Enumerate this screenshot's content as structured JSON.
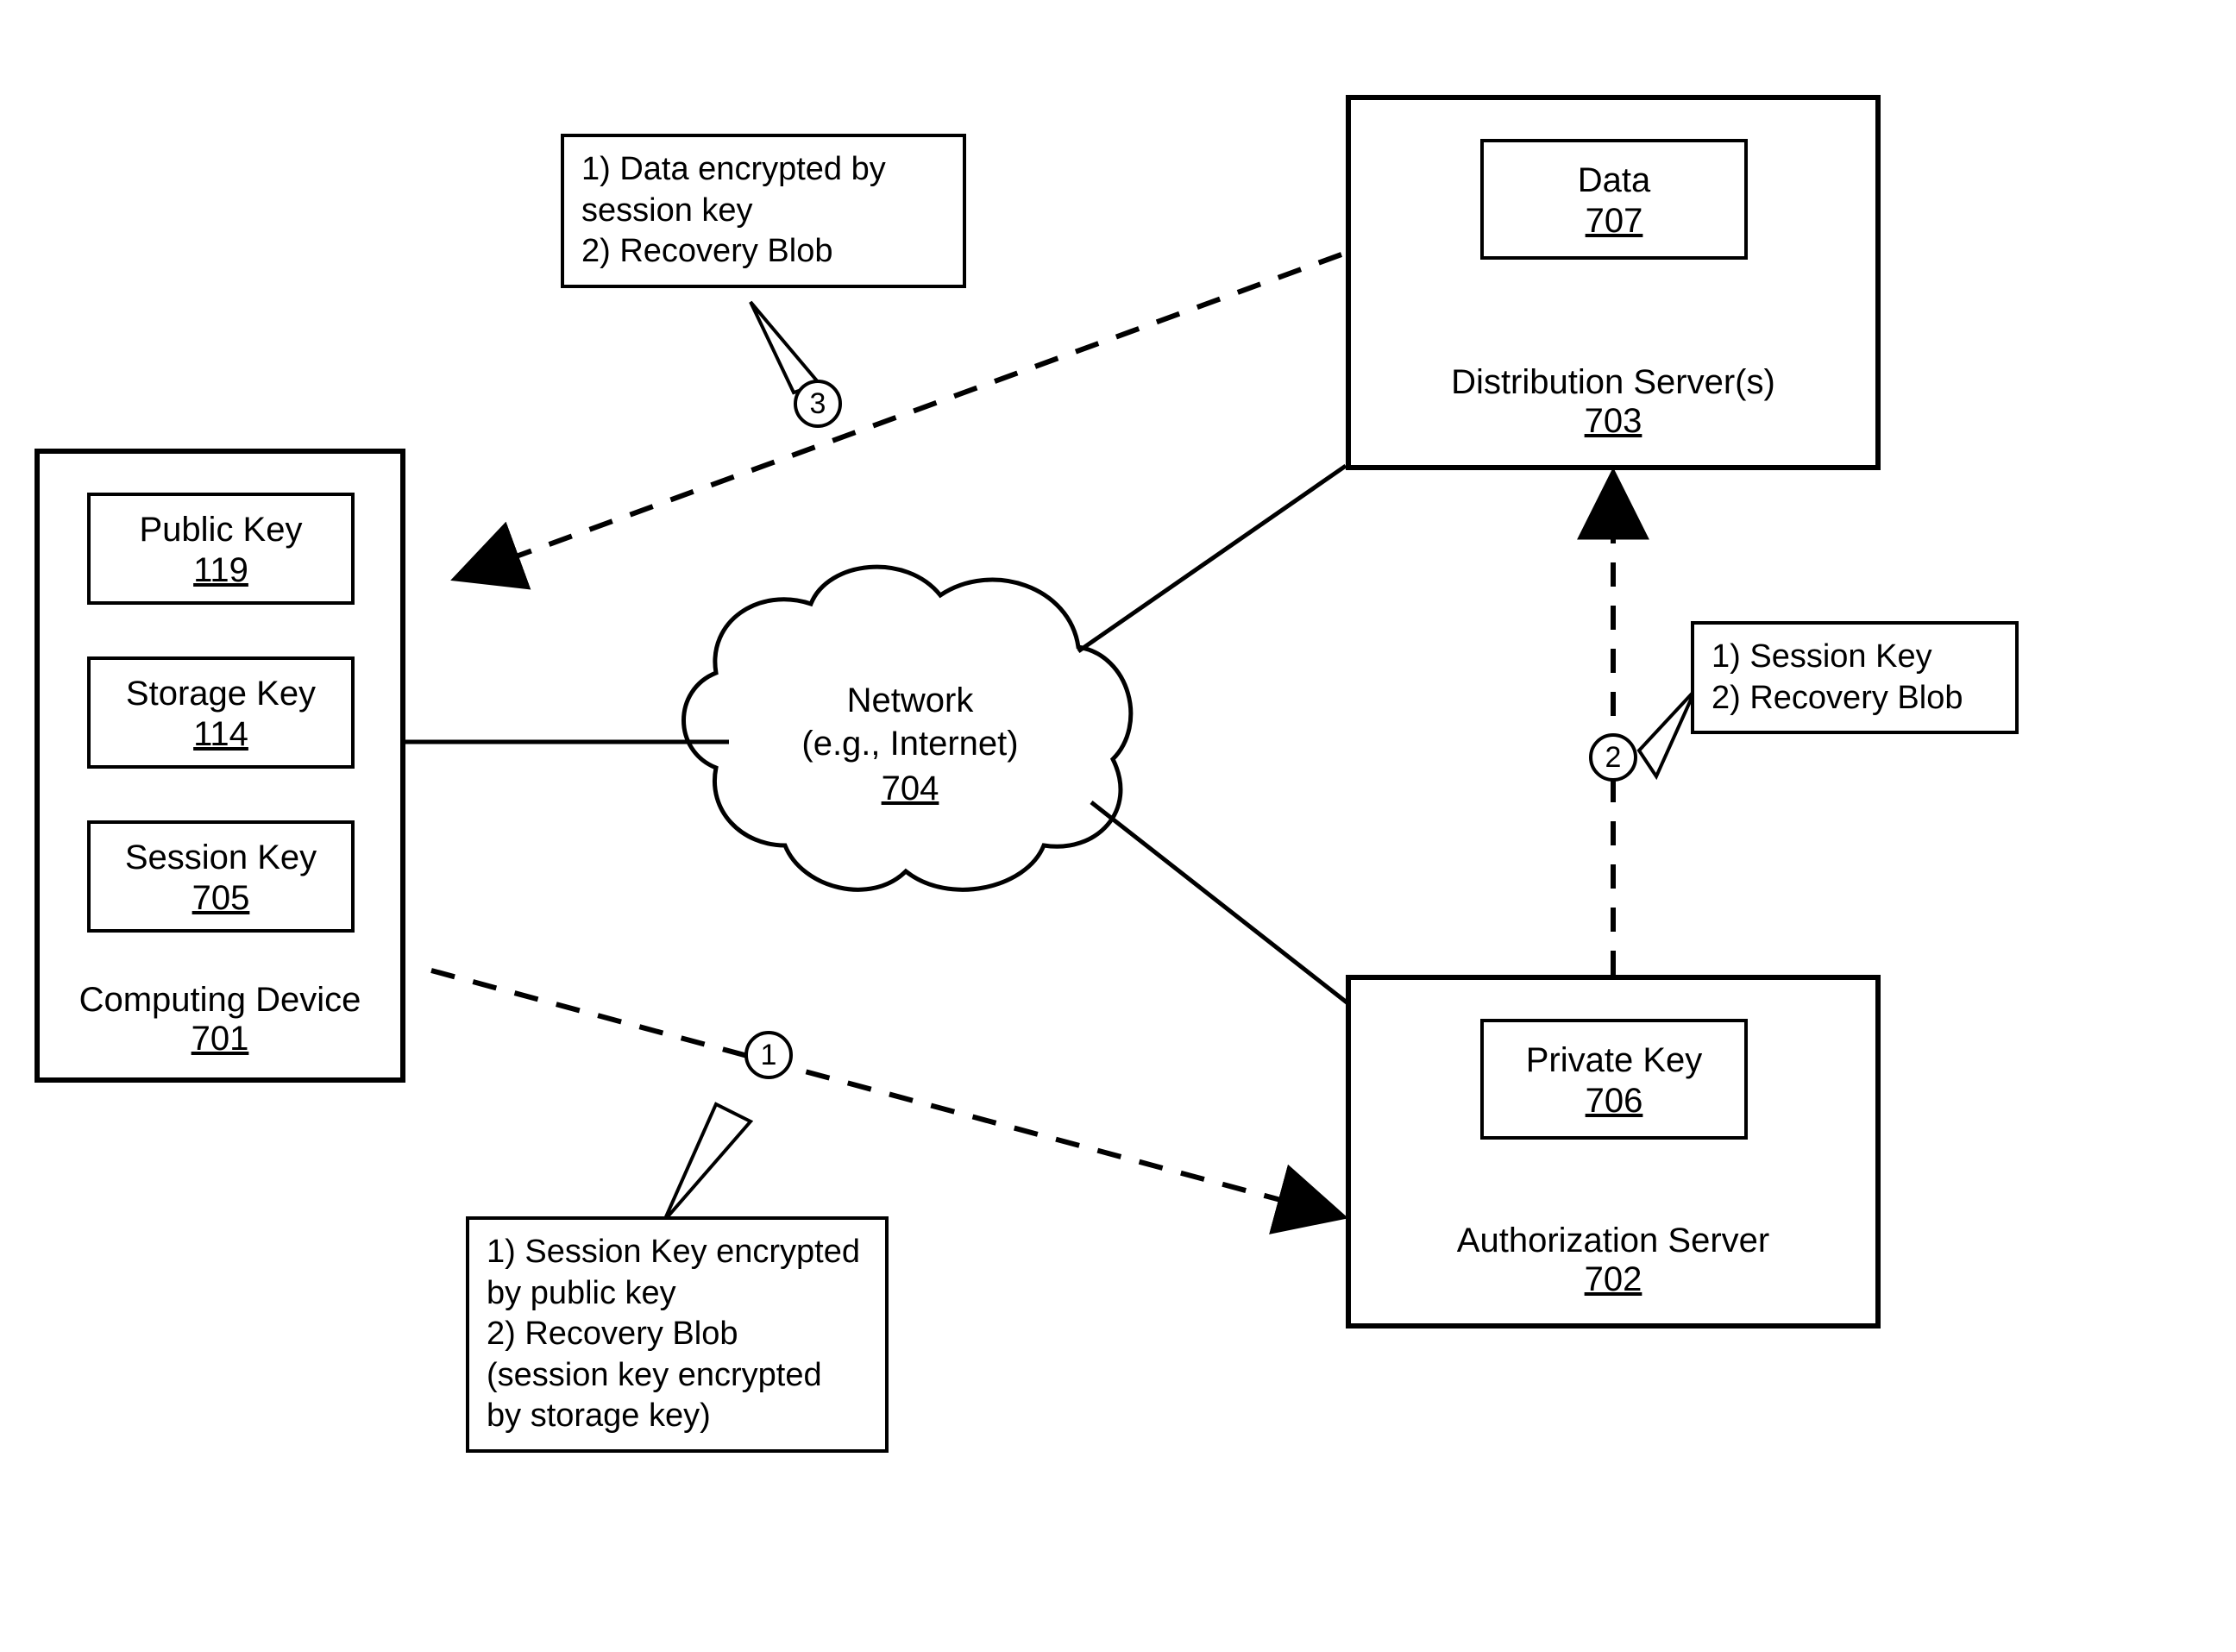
{
  "nodes": {
    "computing_device": {
      "caption_label": "Computing Device",
      "caption_ref": "701",
      "public_key": {
        "label": "Public Key",
        "ref": "119"
      },
      "storage_key": {
        "label": "Storage Key",
        "ref": "114"
      },
      "session_key": {
        "label": "Session Key",
        "ref": "705"
      }
    },
    "distribution_server": {
      "caption_label": "Distribution Server(s)",
      "caption_ref": "703",
      "data": {
        "label": "Data",
        "ref": "707"
      }
    },
    "authorization_server": {
      "caption_label": "Authorization Server",
      "caption_ref": "702",
      "private_key": {
        "label": "Private Key",
        "ref": "706"
      }
    },
    "network": {
      "line1": "Network",
      "line2": "(e.g., Internet)",
      "ref": "704"
    }
  },
  "flows": {
    "step1": {
      "num": "1",
      "text_lines": [
        "1) Session Key encrypted",
        "by public key",
        "2) Recovery Blob",
        "(session key encrypted",
        "by storage key)"
      ]
    },
    "step2": {
      "num": "2",
      "text_lines": [
        "1) Session Key",
        "2) Recovery Blob"
      ]
    },
    "step3": {
      "num": "3",
      "text_lines": [
        "1) Data encrypted by",
        "session key",
        "2) Recovery Blob"
      ]
    }
  }
}
